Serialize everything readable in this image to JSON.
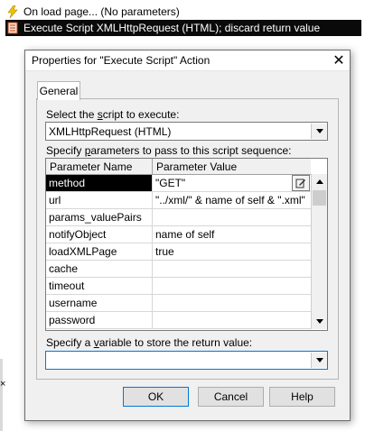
{
  "tree": {
    "onload_label": "On load page... (No parameters)",
    "exec_label": "Execute Script XMLHttpRequest (HTML); discard return value"
  },
  "dialog": {
    "title": "Properties for \"Execute Script\" Action",
    "tab_general": "General",
    "script_label_pre": "Select the ",
    "script_label_u": "s",
    "script_label_post": "cript to execute:",
    "script_value": "XMLHttpRequest (HTML)",
    "params_label_pre": "Specify ",
    "params_label_u": "p",
    "params_label_post": "arameters to pass to this script sequence:",
    "grid": {
      "col_name": "Parameter Name",
      "col_value": "Parameter Value",
      "rows": [
        {
          "name": "method",
          "value": "\"GET\""
        },
        {
          "name": "url",
          "value": "\"../xml/\" & name of self & \".xml\""
        },
        {
          "name": "params_valuePairs",
          "value": ""
        },
        {
          "name": "notifyObject",
          "value": "name of self"
        },
        {
          "name": "loadXMLPage",
          "value": "true"
        },
        {
          "name": "cache",
          "value": ""
        },
        {
          "name": "timeout",
          "value": ""
        },
        {
          "name": "username",
          "value": ""
        },
        {
          "name": "password",
          "value": ""
        }
      ]
    },
    "return_label_pre": "Specify a ",
    "return_label_u": "v",
    "return_label_post": "ariable to store the return value:",
    "return_value": "",
    "ok": "OK",
    "cancel": "Cancel",
    "help": "Help"
  },
  "colors": {
    "selection": "#000000",
    "default_button_border": "#0078d7"
  }
}
